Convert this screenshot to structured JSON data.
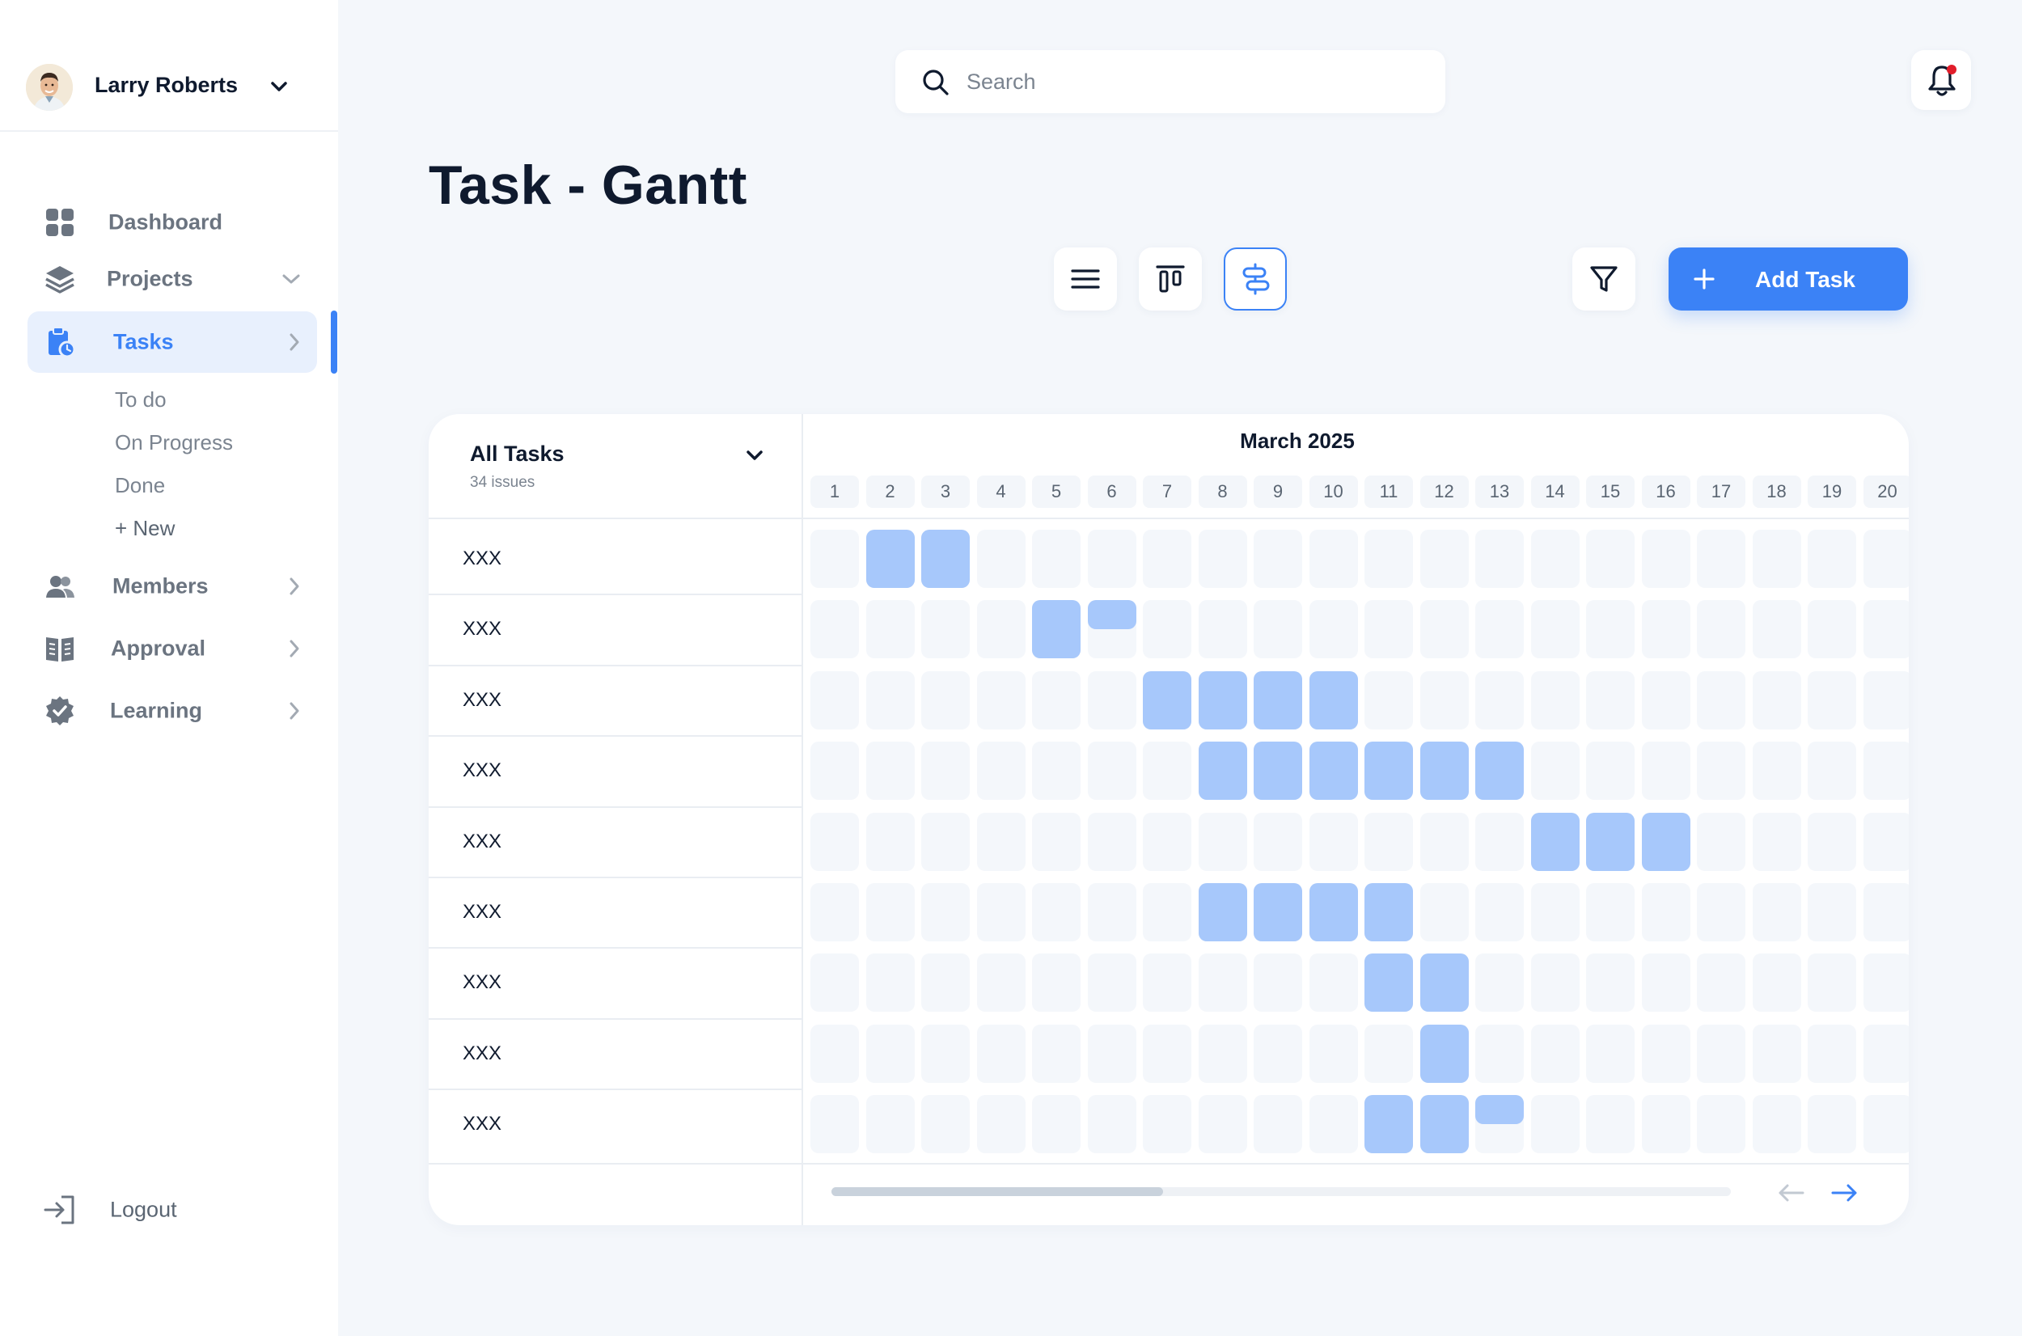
{
  "user": {
    "name": "Larry Roberts"
  },
  "nav": {
    "dashboard": "Dashboard",
    "projects": "Projects",
    "tasks": "Tasks",
    "subitems": [
      "To do",
      "On Progress",
      "Done",
      "+ New"
    ],
    "members": "Members",
    "approval": "Approval",
    "learning": "Learning",
    "logout": "Logout"
  },
  "search": {
    "placeholder": "Search"
  },
  "notifications": {
    "has_unread": true
  },
  "page": {
    "title": "Task - Gantt"
  },
  "toolbar": {
    "views": [
      "list-view",
      "board-view",
      "gantt-view"
    ],
    "selected_view": "gantt-view",
    "add_label": "Add Task"
  },
  "colors": {
    "accent": "#3b82f6",
    "bar": "#a7c8fb",
    "cell": "#f4f7fb",
    "notification_dot": "#e11d2a"
  },
  "gantt": {
    "group_label": "All Tasks",
    "issues_label": "34 issues",
    "month_label": "March 2025",
    "days": [
      "1",
      "2",
      "3",
      "4",
      "5",
      "6",
      "7",
      "8",
      "9",
      "10",
      "11",
      "12",
      "13",
      "14",
      "15",
      "16",
      "17",
      "18",
      "19",
      "20"
    ],
    "tasks": [
      {
        "name": "XXX",
        "days": [
          2,
          3
        ]
      },
      {
        "name": "XXX",
        "days": [
          5,
          6
        ]
      },
      {
        "name": "XXX",
        "days": [
          7,
          8,
          9,
          10
        ]
      },
      {
        "name": "XXX",
        "days": [
          8,
          9,
          10,
          11,
          12,
          13
        ]
      },
      {
        "name": "XXX",
        "days": [
          14,
          15,
          16
        ]
      },
      {
        "name": "XXX",
        "days": [
          8,
          9,
          10,
          11
        ]
      },
      {
        "name": "XXX",
        "days": [
          11,
          12
        ]
      },
      {
        "name": "XXX",
        "days": [
          12
        ]
      },
      {
        "name": "XXX",
        "days": [
          11,
          12,
          13
        ]
      }
    ]
  }
}
